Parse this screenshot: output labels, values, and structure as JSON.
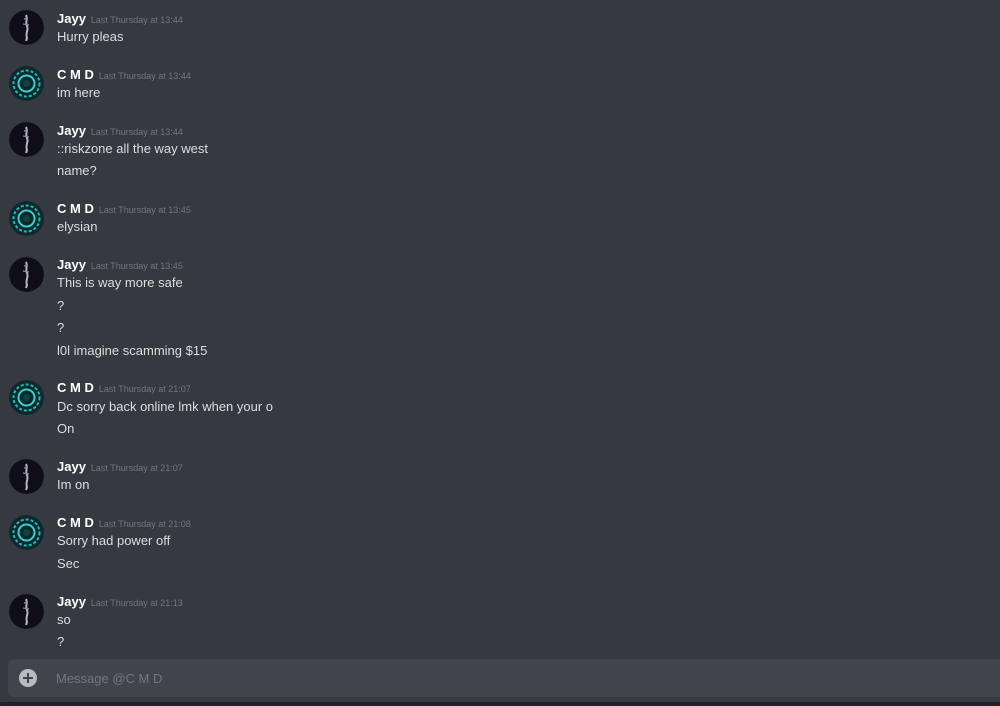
{
  "users": {
    "jayy": {
      "name": "Jayy",
      "avatar_icon": "jayy-avatar-icon"
    },
    "cmd": {
      "name": "C M D",
      "avatar_icon": "cmd-avatar-icon"
    }
  },
  "messages": [
    {
      "author": "Jayy",
      "timestamp": "Last Thursday at 13:44",
      "lines": [
        "Hurry pleas"
      ]
    },
    {
      "author": "C M D",
      "timestamp": "Last Thursday at 13:44",
      "lines": [
        "im here"
      ]
    },
    {
      "author": "Jayy",
      "timestamp": "Last Thursday at 13:44",
      "lines": [
        "::riskzone all the way west",
        "name?"
      ]
    },
    {
      "author": "C M D",
      "timestamp": "Last Thursday at 13:45",
      "lines": [
        "elysian"
      ]
    },
    {
      "author": "Jayy",
      "timestamp": "Last Thursday at 13:45",
      "lines": [
        "This is way more safe",
        "?",
        "?",
        "l0l imagine scamming $15"
      ]
    },
    {
      "author": "C M D",
      "timestamp": "Last Thursday at 21:07",
      "lines": [
        "Dc sorry back online lmk when your o",
        "On"
      ]
    },
    {
      "author": "Jayy",
      "timestamp": "Last Thursday at 21:07",
      "lines": [
        "Im on"
      ]
    },
    {
      "author": "C M D",
      "timestamp": "Last Thursday at 21:08",
      "lines": [
        "Sorry had power off",
        "Sec"
      ]
    },
    {
      "author": "Jayy",
      "timestamp": "Last Thursday at 21:13",
      "lines": [
        "so",
        "?"
      ]
    }
  ],
  "composer": {
    "placeholder": "Message @C M D",
    "value": ""
  },
  "colors": {
    "background": "#36393f",
    "composer": "#40444b",
    "author": "#ffffff",
    "text": "#dcddde",
    "timestamp": "#72767d"
  }
}
